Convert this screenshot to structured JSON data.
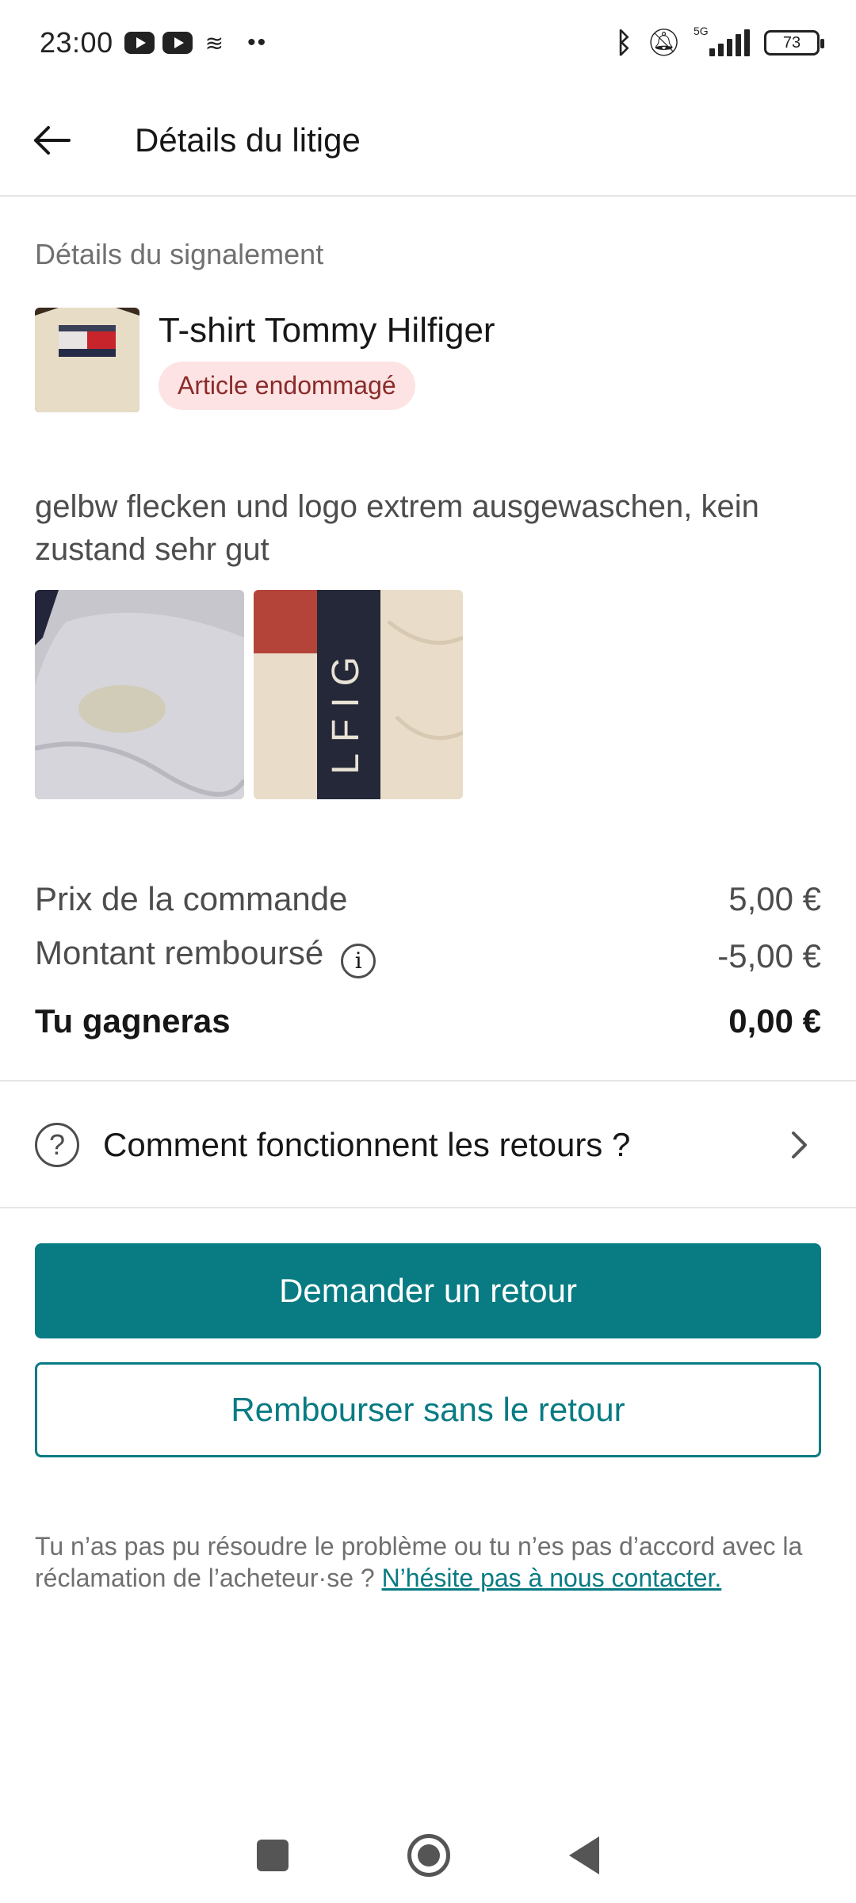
{
  "status_bar": {
    "time": "23:00",
    "battery": "73",
    "network": "5G"
  },
  "header": {
    "title": "Détails du litige"
  },
  "report": {
    "section_label": "Détails du signalement",
    "item_title": "T-shirt Tommy Hilfiger",
    "badge": "Article endommagé",
    "description": "gelbw flecken und logo extrem ausgewaschen, kein zustand sehr gut"
  },
  "summary": {
    "order_price_label": "Prix de la commande",
    "order_price_value": "5,00 €",
    "refund_label": "Montant remboursé",
    "refund_value": "-5,00 €",
    "earn_label": "Tu gagneras",
    "earn_value": "0,00 €"
  },
  "returns": {
    "label": "Comment fonctionnent les retours ?"
  },
  "actions": {
    "primary": "Demander un retour",
    "secondary": "Rembourser sans le retour"
  },
  "footer": {
    "text": "Tu n’as pas pu résoudre le problème ou tu n’es pas d’accord avec la réclamation de l’acheteur·se ?",
    "link": "N’hésite pas à nous contacter."
  },
  "colors": {
    "accent": "#087b83",
    "badge_bg": "#fde3e3",
    "badge_text": "#8a2b2b"
  }
}
